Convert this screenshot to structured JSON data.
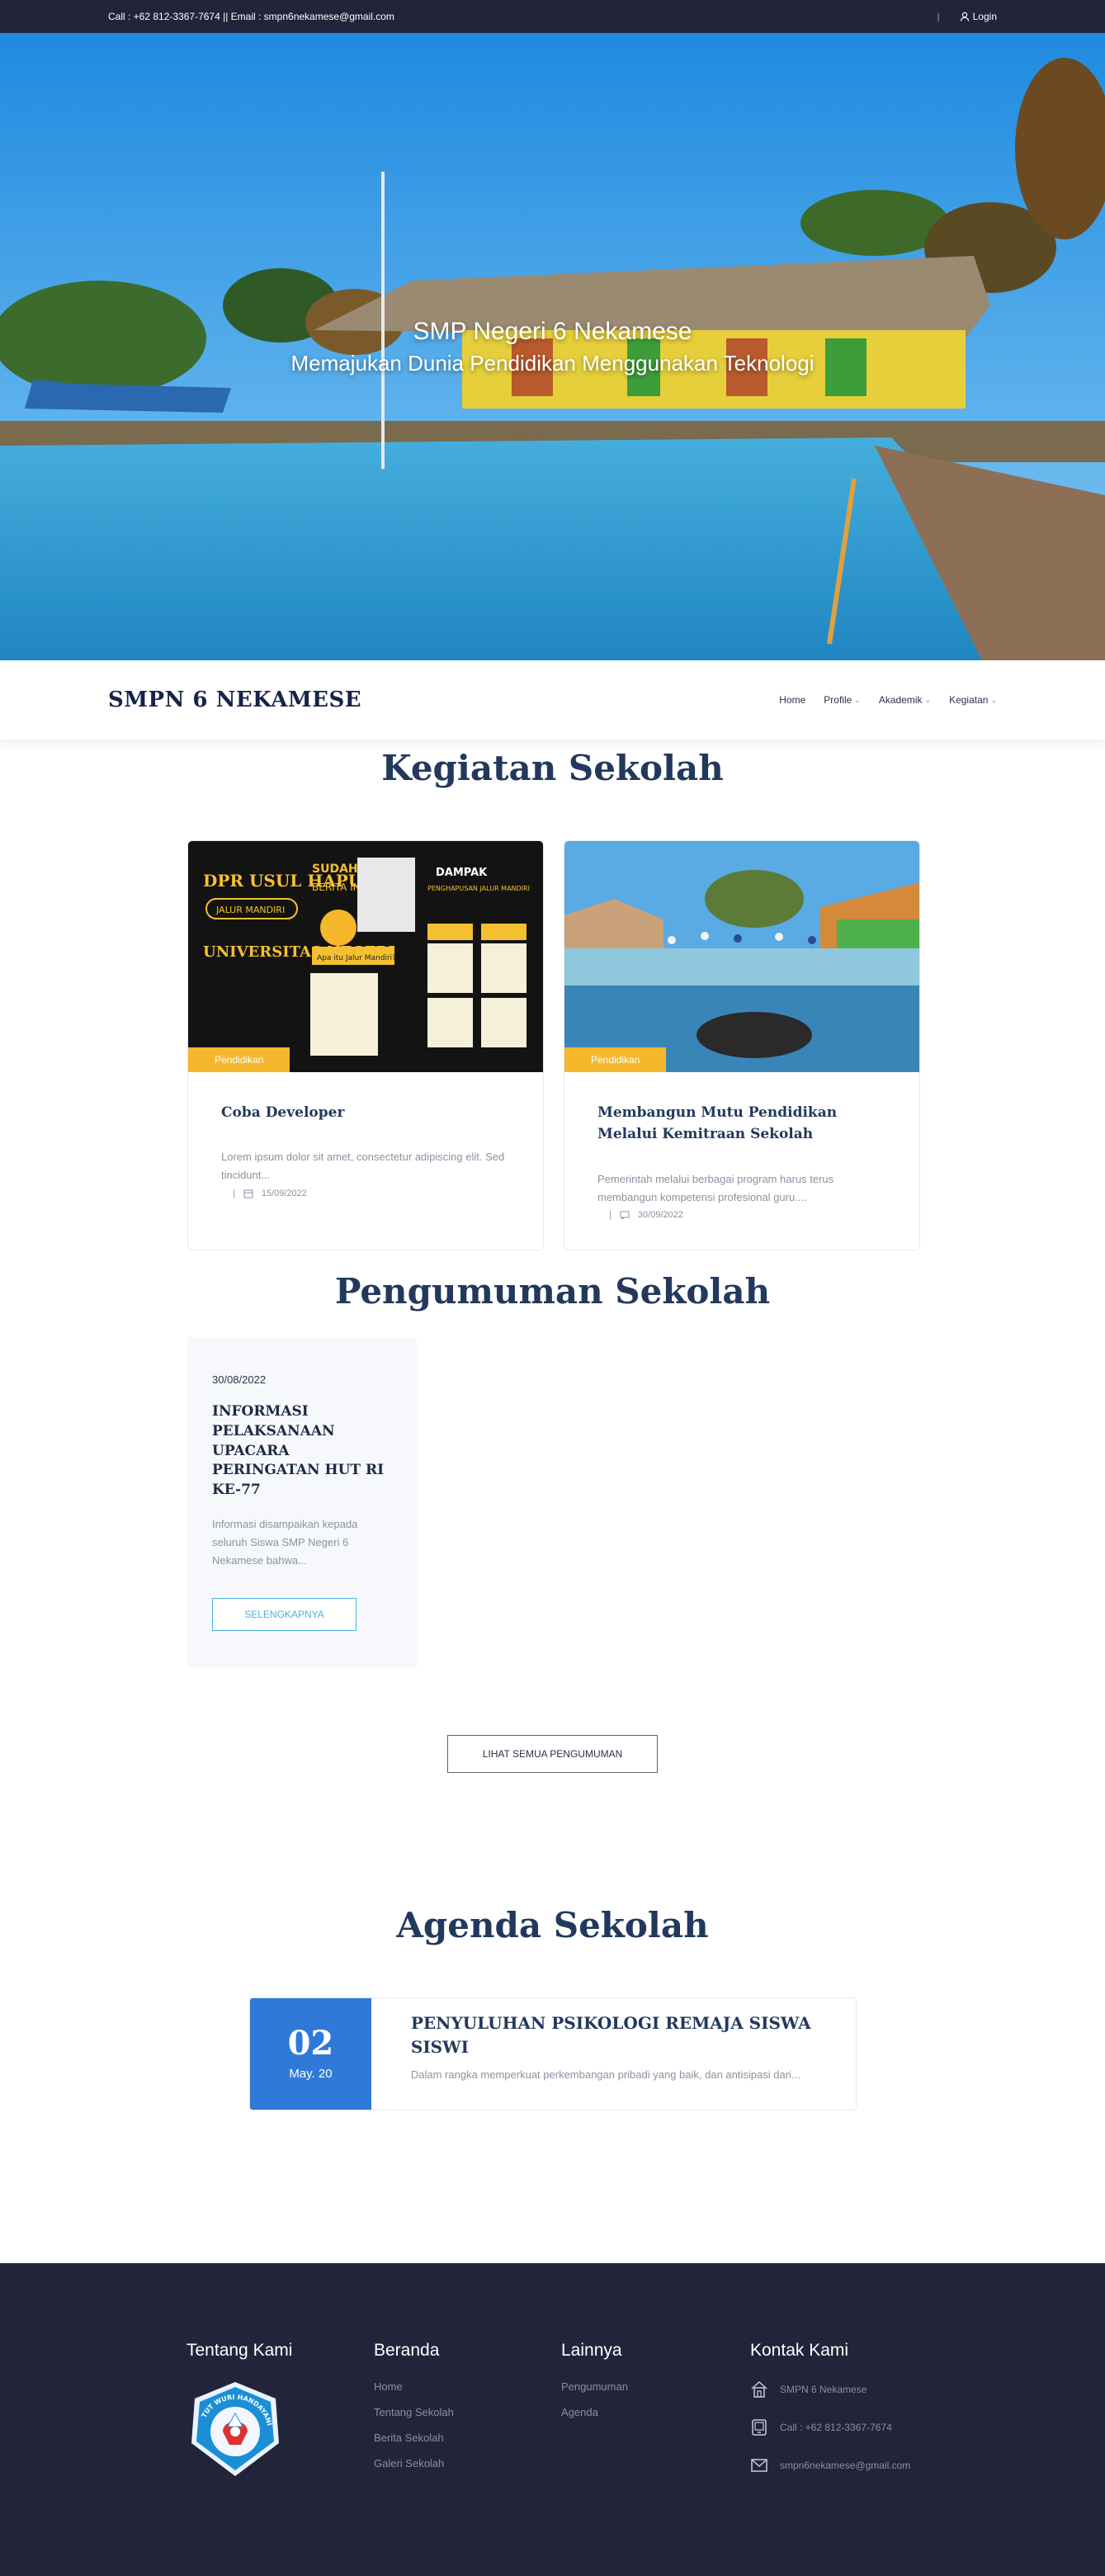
{
  "topbar": {
    "contact_text": "Call : +62 812-3367-7674 || Email : smpn6nekamese@gmail.com",
    "separator": "|",
    "login_label": "Login"
  },
  "hero": {
    "title": "SMP Negeri 6 Nekamese",
    "subtitle": "Memajukan Dunia Pendidikan Menggunakan Teknologi"
  },
  "navbar": {
    "brand": "SMPN 6 NEKAMESE",
    "items": [
      {
        "label": "Home"
      },
      {
        "label": "Profile"
      },
      {
        "label": "Akademik"
      },
      {
        "label": "Kegiatan"
      }
    ]
  },
  "kegiatan": {
    "title": "Kegiatan Sekolah",
    "cards": [
      {
        "category": "Pendidikan",
        "title": "Coba Developer",
        "excerpt": "Lorem ipsum dolor sit amet, consectetur adipiscing elit. Sed tincidunt...",
        "meta_sep": "|",
        "date": "15/09/2022",
        "image_text": {
          "left_top": "DPR USUL HAPUS",
          "left_tag": "JALUR MANDIRI",
          "left_bottom": "UNIVERSITAS NEGERI",
          "mid_top": "SUDAH TAU",
          "mid_sub": "BERITA INI?",
          "question": "Apa itu Jalur Mandiri?",
          "right_top": "DAMPAK",
          "right_sub": "PENGHAPUSAN JALUR MANDIRI"
        }
      },
      {
        "category": "Pendidikan",
        "title": "Membangun Mutu Pendidikan Melalui Kemitraan Sekolah",
        "excerpt": "Pemerintah melalui berbagai program harus terus membangun kompetensi profesional guru....",
        "meta_sep": "|",
        "date": "30/09/2022"
      }
    ]
  },
  "pengumuman": {
    "title": "Pengumuman Sekolah",
    "item": {
      "date": "30/08/2022",
      "title": "INFORMASI PELAKSANAAN UPACARA PERINGATAN HUT RI KE-77",
      "excerpt": "Informasi disampaikan kepada seluruh Siswa SMP Negeri 6 Nekamese bahwa...",
      "button": "SELENGKAPNYA"
    },
    "all_button": "LIHAT SEMUA PENGUMUMAN"
  },
  "agenda": {
    "title": "Agenda Sekolah",
    "item": {
      "day": "02",
      "month": "May. 20",
      "title": "PENYULUHAN PSIKOLOGI REMAJA SISWA SISWI",
      "excerpt": "Dalam rangka memperkuat perkembangan pribadi yang baik, dan antisipasi dari..."
    }
  },
  "footer": {
    "tentang": {
      "title": "Tentang Kami",
      "logo_text": "TUT WURI HANDAYANI"
    },
    "beranda": {
      "title": "Beranda",
      "links": [
        "Home",
        "Tentang Sekolah",
        "Berita Sekolah",
        "Galeri Sekolah"
      ]
    },
    "lainnya": {
      "title": "Lainnya",
      "links": [
        "Pengumuman",
        "Agenda"
      ]
    },
    "kontak": {
      "title": "Kontak Kami",
      "items": [
        {
          "icon": "home-icon",
          "text": "SMPN 6 Nekamese"
        },
        {
          "icon": "phone-icon",
          "text": "Call : +62 812-3367-7674"
        },
        {
          "icon": "mail-icon",
          "text": "smpn6nekamese@gmail.com"
        }
      ]
    }
  },
  "colors": {
    "topbar_bg": "#22243a",
    "heading": "#22395c",
    "badge": "#f5b72b",
    "agenda_date_bg": "#2f7ad8",
    "accent_outline": "#4ab3d8",
    "footer_bg": "#22243a"
  }
}
